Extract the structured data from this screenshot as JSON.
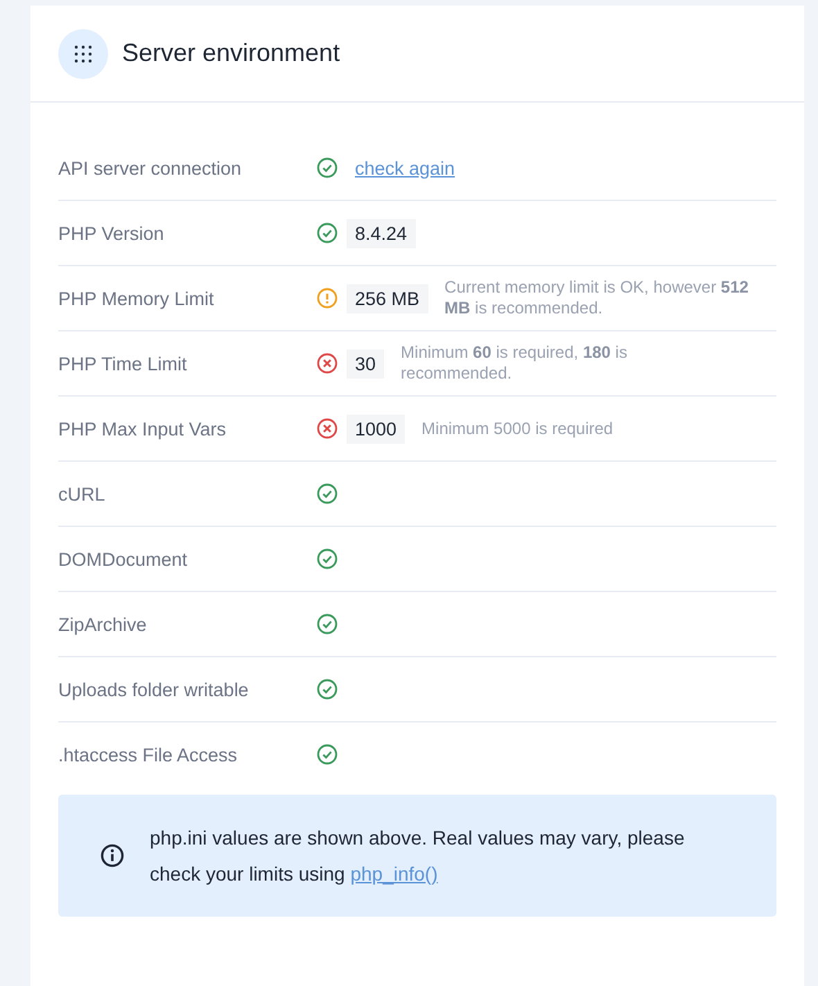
{
  "card": {
    "title": "Server environment"
  },
  "checks": [
    {
      "label": "API server connection",
      "kind": "ok",
      "link": "check again"
    },
    {
      "label": "PHP Version",
      "kind": "ok",
      "value": "8.4.24"
    },
    {
      "label": "PHP Memory Limit",
      "kind": "warning",
      "value": "256 MB",
      "note": "Current memory limit is OK, however **512 MB** is recommended."
    },
    {
      "label": "PHP Time Limit",
      "kind": "error",
      "value": "30",
      "note": "Minimum **60** is required, **180** is recommended."
    },
    {
      "label": "PHP Max Input Vars",
      "kind": "error",
      "value": "1000",
      "note": "Minimum 5000 is required"
    },
    {
      "label": "cURL",
      "kind": "ok"
    },
    {
      "label": "DOMDocument",
      "kind": "ok"
    },
    {
      "label": "ZipArchive",
      "kind": "ok"
    },
    {
      "label": "Uploads folder writable",
      "kind": "ok"
    },
    {
      "label": ".htaccess File Access",
      "kind": "ok"
    }
  ],
  "notice": {
    "text": "php.ini values are shown above. Real values may vary, please check your limits using",
    "link": "php_info()"
  }
}
